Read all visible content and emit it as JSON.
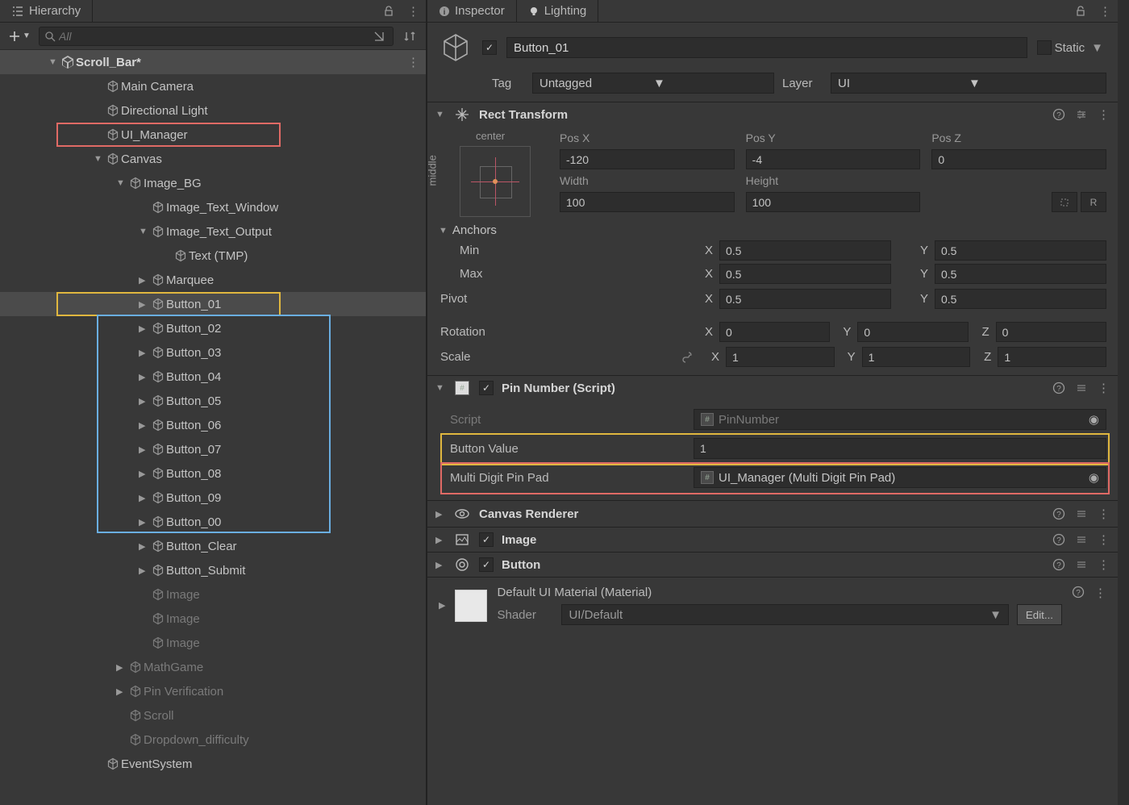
{
  "hierarchy": {
    "tab": "Hierarchy",
    "search_placeholder": "All",
    "scene": "Scroll_Bar*",
    "items": [
      {
        "label": "Main Camera",
        "indent": 2,
        "arrow": "",
        "dim": false
      },
      {
        "label": "Directional Light",
        "indent": 2,
        "arrow": "",
        "dim": false
      },
      {
        "label": "UI_Manager",
        "indent": 2,
        "arrow": "",
        "dim": false,
        "hl": "red"
      },
      {
        "label": "Canvas",
        "indent": 2,
        "arrow": "▼",
        "dim": false
      },
      {
        "label": "Image_BG",
        "indent": 3,
        "arrow": "▼",
        "dim": false
      },
      {
        "label": "Image_Text_Window",
        "indent": 4,
        "arrow": "",
        "dim": false
      },
      {
        "label": "Image_Text_Output",
        "indent": 4,
        "arrow": "▼",
        "dim": false
      },
      {
        "label": "Text (TMP)",
        "indent": 5,
        "arrow": "",
        "dim": false
      },
      {
        "label": "Marquee",
        "indent": 4,
        "arrow": "▶",
        "dim": false
      },
      {
        "label": "Button_01",
        "indent": 4,
        "arrow": "▶",
        "dim": false,
        "selected": true,
        "hl": "yellow"
      },
      {
        "label": "Button_02",
        "indent": 4,
        "arrow": "▶",
        "dim": false,
        "hl": "blue-start"
      },
      {
        "label": "Button_03",
        "indent": 4,
        "arrow": "▶",
        "dim": false
      },
      {
        "label": "Button_04",
        "indent": 4,
        "arrow": "▶",
        "dim": false
      },
      {
        "label": "Button_05",
        "indent": 4,
        "arrow": "▶",
        "dim": false
      },
      {
        "label": "Button_06",
        "indent": 4,
        "arrow": "▶",
        "dim": false
      },
      {
        "label": "Button_07",
        "indent": 4,
        "arrow": "▶",
        "dim": false
      },
      {
        "label": "Button_08",
        "indent": 4,
        "arrow": "▶",
        "dim": false
      },
      {
        "label": "Button_09",
        "indent": 4,
        "arrow": "▶",
        "dim": false
      },
      {
        "label": "Button_00",
        "indent": 4,
        "arrow": "▶",
        "dim": false,
        "hl": "blue-end"
      },
      {
        "label": "Button_Clear",
        "indent": 4,
        "arrow": "▶",
        "dim": false
      },
      {
        "label": "Button_Submit",
        "indent": 4,
        "arrow": "▶",
        "dim": false
      },
      {
        "label": "Image",
        "indent": 4,
        "arrow": "",
        "dim": true
      },
      {
        "label": "Image",
        "indent": 4,
        "arrow": "",
        "dim": true
      },
      {
        "label": "Image",
        "indent": 4,
        "arrow": "",
        "dim": true
      },
      {
        "label": "MathGame",
        "indent": 3,
        "arrow": "▶",
        "dim": true
      },
      {
        "label": "Pin Verification",
        "indent": 3,
        "arrow": "▶",
        "dim": true
      },
      {
        "label": "Scroll",
        "indent": 3,
        "arrow": "",
        "dim": true
      },
      {
        "label": "Dropdown_difficulty",
        "indent": 3,
        "arrow": "",
        "dim": true
      },
      {
        "label": "EventSystem",
        "indent": 2,
        "arrow": "",
        "dim": false
      }
    ]
  },
  "inspector": {
    "tab1": "Inspector",
    "tab2": "Lighting",
    "name": "Button_01",
    "static_label": "Static",
    "tag_label": "Tag",
    "tag_value": "Untagged",
    "layer_label": "Layer",
    "layer_value": "UI",
    "rect_transform": {
      "title": "Rect Transform",
      "center": "center",
      "middle": "middle",
      "posx_label": "Pos X",
      "posx": "-120",
      "posy_label": "Pos Y",
      "posy": "-4",
      "posz_label": "Pos Z",
      "posz": "0",
      "width_label": "Width",
      "width": "100",
      "height_label": "Height",
      "height": "100",
      "anchors": "Anchors",
      "min": "Min",
      "min_x": "0.5",
      "min_y": "0.5",
      "max": "Max",
      "max_x": "0.5",
      "max_y": "0.5",
      "pivot": "Pivot",
      "pivot_x": "0.5",
      "pivot_y": "0.5",
      "rotation": "Rotation",
      "rot_x": "0",
      "rot_y": "0",
      "rot_z": "0",
      "scale": "Scale",
      "scale_x": "1",
      "scale_y": "1",
      "scale_z": "1",
      "x": "X",
      "y": "Y",
      "z": "Z"
    },
    "pin_number": {
      "title": "Pin Number (Script)",
      "script_label": "Script",
      "script_value": "PinNumber",
      "bv_label": "Button Value",
      "bv_value": "1",
      "mdpp_label": "Multi Digit Pin Pad",
      "mdpp_value": "UI_Manager (Multi Digit Pin Pad)"
    },
    "canvas_renderer": "Canvas Renderer",
    "image_comp": "Image",
    "button_comp": "Button",
    "material": {
      "title": "Default UI Material (Material)",
      "shader_label": "Shader",
      "shader_value": "UI/Default",
      "edit": "Edit..."
    }
  }
}
